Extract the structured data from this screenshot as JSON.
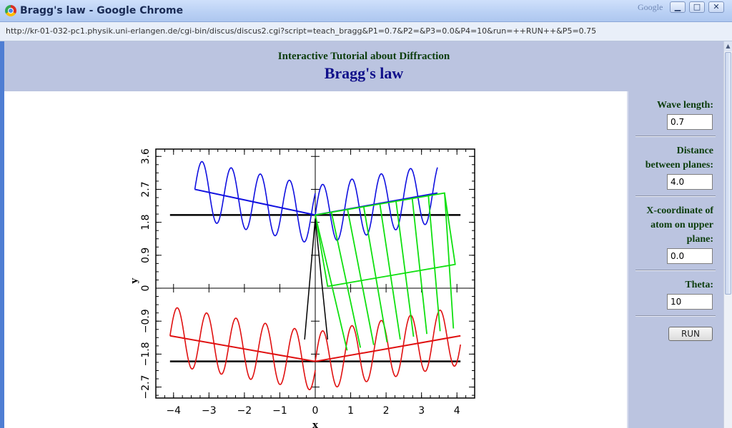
{
  "window": {
    "title": "Bragg's law - Google Chrome",
    "brand": "Google",
    "controls": {
      "minimize": "▁",
      "maximize": "□",
      "close": "✕"
    }
  },
  "address_bar": {
    "url": "http://kr-01-032-pc1.physik.uni-erlangen.de/cgi-bin/discus/discus2.cgi?script=teach_bragg&P1=0.7&P2=&P3=0.0&P4=10&run=++RUN++&P5=0.75"
  },
  "page": {
    "subtitle": "Interactive Tutorial about Diffraction",
    "title": "Bragg's law"
  },
  "form": {
    "wave_length": {
      "label": "Wave length:",
      "value": "0.7"
    },
    "distance": {
      "label_line1": "Distance",
      "label_line2": "between planes:",
      "value": "4.0"
    },
    "xcoord": {
      "label_line1": "X-coordinate of",
      "label_line2": "atom on upper",
      "label_line3": "plane:",
      "value": "0.0"
    },
    "theta": {
      "label": "Theta:",
      "value": "10"
    },
    "run_label": "RUN"
  },
  "colors": {
    "upper_wave": "#1010e0",
    "lower_wave": "#e01010",
    "path_wave": "#10e010",
    "planes": "#000000"
  },
  "chart_data": {
    "type": "line",
    "xlabel": "x",
    "ylabel": "y",
    "xlim": [
      -4.5,
      4.5
    ],
    "ylim": [
      -3.0,
      3.8
    ],
    "x_ticks": [
      -4,
      -3,
      -2,
      -1,
      0,
      1,
      2,
      3,
      4
    ],
    "y_ticks": [
      -2.7,
      -1.8,
      -0.9,
      0,
      0.9,
      1.8,
      2.7,
      3.6
    ],
    "x_tick_labels": [
      "−4",
      "−3",
      "−2",
      "−1",
      "0",
      "1",
      "2",
      "3",
      "4"
    ],
    "y_tick_labels": [
      "−2.7",
      "−1.8",
      "−0.9",
      "0",
      "0.9",
      "1.8",
      "2.7",
      "3.6"
    ],
    "planes": [
      {
        "name": "upper-plane",
        "y": 2.0,
        "x_range": [
          -4.1,
          4.1
        ]
      },
      {
        "name": "lower-plane",
        "y": -2.0,
        "x_range": [
          -4.1,
          4.1
        ]
      }
    ],
    "series": [
      {
        "key": "upper_incident",
        "color": "#1010e0",
        "x": [
          -3.4,
          0.0
        ],
        "y": [
          2.7,
          2.0
        ],
        "amp": 0.8,
        "wavelength": 0.7
      },
      {
        "key": "upper_reflected",
        "color": "#1010e0",
        "x": [
          0.0,
          3.45
        ],
        "y": [
          2.0,
          2.6
        ],
        "amp": 0.8,
        "wavelength": 0.7
      },
      {
        "key": "lower_incident",
        "color": "#e01010",
        "x": [
          -4.1,
          0.0
        ],
        "y": [
          -1.3,
          -2.0
        ],
        "amp": 0.8,
        "wavelength": 0.7
      },
      {
        "key": "lower_reflected",
        "color": "#e01010",
        "x": [
          0.0,
          4.1
        ],
        "y": [
          -2.0,
          -1.3
        ],
        "amp": 0.8,
        "wavelength": 0.7
      },
      {
        "key": "path_difference",
        "color": "#10e010",
        "x": [
          0.0,
          3.65
        ],
        "y": [
          2.0,
          2.6
        ],
        "x2": [
          0.35,
          3.95
        ],
        "y2": [
          0.05,
          0.65
        ]
      },
      {
        "key": "construction_lines",
        "color": "#000000",
        "x": [
          -0.3,
          0.0,
          0.35
        ],
        "y": [
          -1.4,
          1.9,
          -1.4
        ]
      }
    ]
  }
}
